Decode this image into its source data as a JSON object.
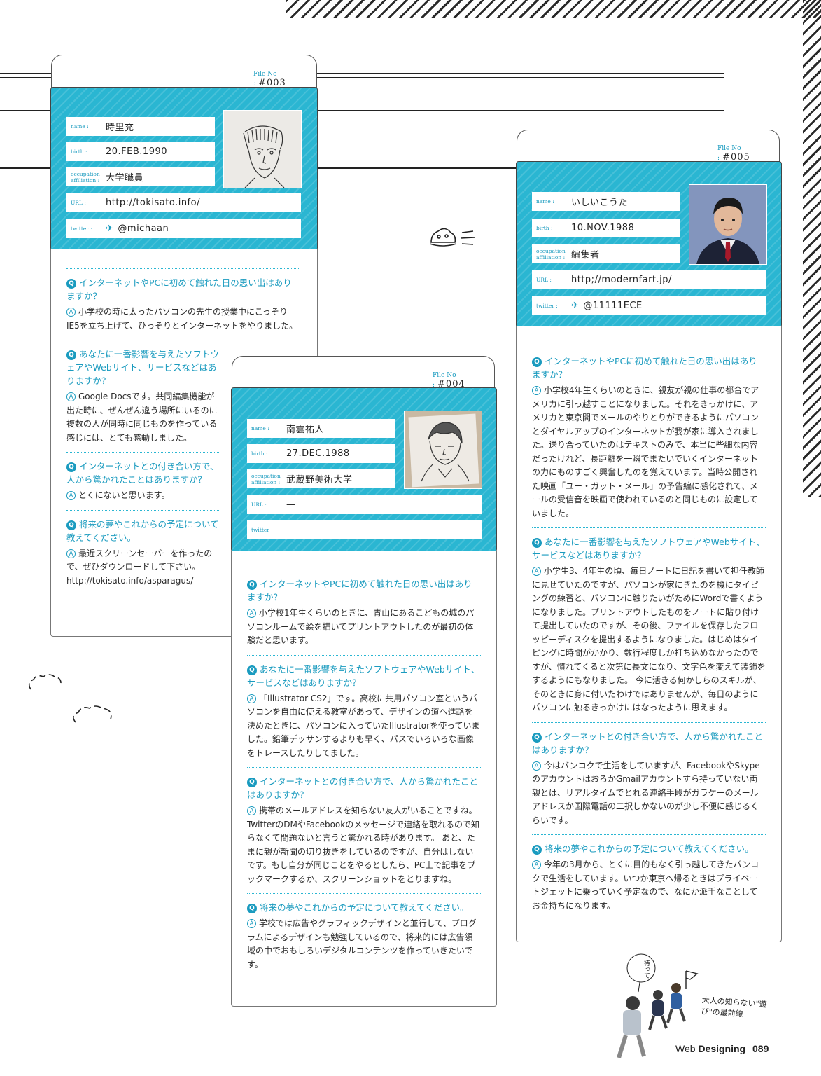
{
  "labels": {
    "file_no": "File No :",
    "name": "name :",
    "birth": "birth :",
    "occupation_line1": "occupation",
    "occupation_line2": "affiliation :",
    "url": "URL :",
    "twitter": "twitter :",
    "q_badge": "Q",
    "a_badge": "A"
  },
  "cards": [
    {
      "file_no": "#003",
      "name": "時里充",
      "birth": "20.FEB.1990",
      "occupation": "大学職員",
      "url": "http://tokisato.info/",
      "twitter": "@michaan",
      "photo": "pencil-drawn-portrait",
      "qa": [
        {
          "q": "インターネットやPCに初めて触れた日の思い出はありますか？",
          "a": "小学校の時に太ったパソコンの先生の授業中にこっそりIE5を立ち上げて、ひっそりとインターネットをやりました。"
        },
        {
          "q": "あなたに一番影響を与えたソフトウェアやWebサイト、サービスなどはありますか？",
          "a": "Google Docsです。共同編集機能が出た時に、ぜんぜん違う場所にいるのに複数の人が同時に同じものを作っている感じには、とても感動しました。"
        },
        {
          "q": "インターネットとの付き合い方で、人から驚かれたことはありますか？",
          "a": "とくにないと思います。"
        },
        {
          "q": "将来の夢やこれからの予定について教えてください。",
          "a": "最近スクリーンセーバーを作ったので、ぜひダウンロードして下さい。 http://tokisato.info/asparagus/"
        }
      ]
    },
    {
      "file_no": "#004",
      "name": "南雲祐人",
      "birth": "27.DEC.1988",
      "occupation": "武蔵野美術大学",
      "url": "—",
      "twitter": "—",
      "photo": "pencil-drawn-portrait",
      "qa": [
        {
          "q": "インターネットやPCに初めて触れた日の思い出はありますか？",
          "a": "小学校1年生くらいのときに、青山にあるこどもの城のパソコンルームで絵を描いてプリントアウトしたのが最初の体験だと思います。"
        },
        {
          "q": "あなたに一番影響を与えたソフトウェアやWebサイト、サービスなどはありますか？",
          "a": "「Illustrator CS2」です。高校に共用パソコン室というパソコンを自由に使える教室があって、デザインの道へ進路を決めたときに、パソコンに入っていたIllustratorを使っていました。鉛筆デッサンするよりも早く、パスでいろいろな画像をトレースしたりしてました。"
        },
        {
          "q": "インターネットとの付き合い方で、人から驚かれたことはありますか？",
          "a": "携帯のメールアドレスを知らない友人がいることですね。TwitterのDMやFacebookのメッセージで連絡を取れるので知らなくて問題ないと言うと驚かれる時があります。 あと、たまに親が新聞の切り抜きをしているのですが、自分はしないです。もし自分が同じことをやるとしたら、PC上で記事をブックマークするか、スクリーンショットをとりますね。"
        },
        {
          "q": "将来の夢やこれからの予定について教えてください。",
          "a": "学校では広告やグラフィックデザインと並行して、プログラムによるデザインも勉強しているので、将来的には広告領域の中でおもしろいデジタルコンテンツを作っていきたいです。"
        }
      ]
    },
    {
      "file_no": "#005",
      "name": "いしいこうた",
      "birth": "10.NOV.1988",
      "occupation": "編集者",
      "url": "http;//modernfart.jp/",
      "twitter": "@11111ECE",
      "photo": "school-portrait-photo",
      "qa": [
        {
          "q": "インターネットやPCに初めて触れた日の思い出はありますか？",
          "a": "小学校4年生くらいのときに、親友が親の仕事の都合でアメリカに引っ越すことになりました。それをきっかけに、アメリカと東京間でメールのやりとりができるようにパソコンとダイヤルアップのインターネットが我が家に導入されました。送り合っていたのはテキストのみで、本当に些細な内容だったけれど、長距離を一瞬でまたいでいくインターネットの力にものすごく興奮したのを覚えています。当時公開された映画「ユー・ガット・メール」の予告編に感化されて、メールの受信音を映画で使われているのと同じものに設定していました。"
        },
        {
          "q": "あなたに一番影響を与えたソフトウェアやWebサイト、サービスなどはありますか？",
          "a": "小学生3、4年生の頃、毎日ノートに日記を書いて担任教師に見せていたのですが、パソコンが家にきたのを機にタイピングの練習と、パソコンに触りたいがためにWordで書くようになりました。プリントアウトしたものをノートに貼り付けて提出していたのですが、その後、ファイルを保存したフロッピーディスクを提出するようになりました。はじめはタイピングに時間がかかり、数行程度しか打ち込めなかったのですが、慣れてくると次第に長文になり、文字色を変えて装飾をするようにもなりました。 今に活きる何かしらのスキルが、そのときに身に付いたわけではありませんが、毎日のようにパソコンに触るきっかけにはなったように思えます。"
        },
        {
          "q": "インターネットとの付き合い方で、人から驚かれたことはありますか？",
          "a": "今はバンコクで生活をしていますが、FacebookやSkypeのアカウントはおろかGmailアカウントすら持っていない両親とは、リアルタイムでとれる連絡手段がガラケーのメールアドレスか国際電話の二択しかないのが少し不便に感じるくらいです。"
        },
        {
          "q": "将来の夢やこれからの予定について教えてください。",
          "a": "今年の3月から、とくに目的もなく引っ越してきたバンコクで生活をしています。いつか東京へ帰るときはプライベートジェットに乗っていく予定なので、なにか派手なことしてお金持ちになります。"
        }
      ]
    }
  ],
  "handwriting": {
    "bubble": "待ってー",
    "tagline": "大人の知らない\"遊び\"の最前線"
  },
  "footer": {
    "brand_regular": "Web",
    "brand_bold": "Designing",
    "page": "089"
  }
}
